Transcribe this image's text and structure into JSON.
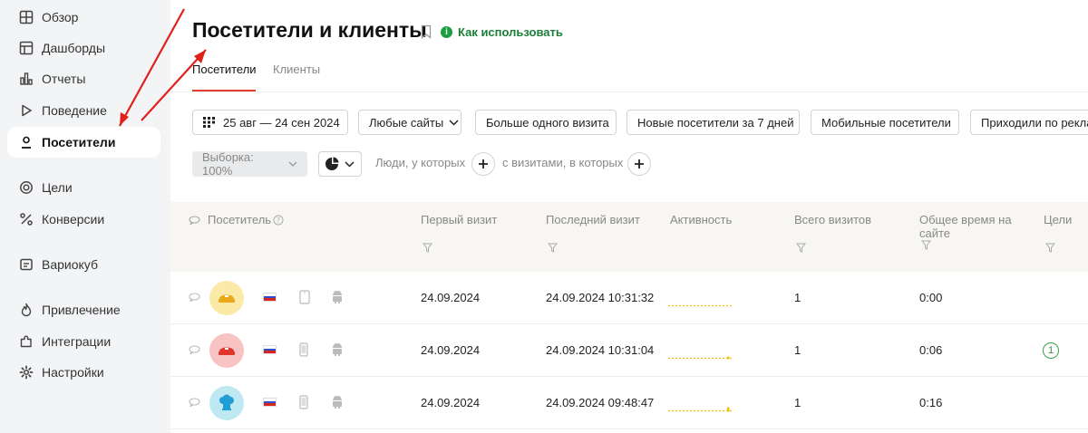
{
  "sidebar": {
    "items": [
      {
        "label": "Обзор",
        "icon": "grid-icon",
        "active": false
      },
      {
        "label": "Дашборды",
        "icon": "dashboard-icon",
        "active": false
      },
      {
        "label": "Отчеты",
        "icon": "bar-chart-icon",
        "active": false
      },
      {
        "label": "Поведение",
        "icon": "play-icon",
        "active": false
      },
      {
        "label": "Посетители",
        "icon": "person-icon",
        "active": true
      },
      {
        "label": "Цели",
        "icon": "target-icon",
        "active": false
      },
      {
        "label": "Конверсии",
        "icon": "percent-icon",
        "active": false
      },
      {
        "label": "Вариокуб",
        "icon": "variocube-icon",
        "active": false
      },
      {
        "label": "Привлечение",
        "icon": "flame-icon",
        "active": false
      },
      {
        "label": "Интеграции",
        "icon": "puzzle-icon",
        "active": false
      },
      {
        "label": "Настройки",
        "icon": "gear-icon",
        "active": false
      }
    ]
  },
  "header": {
    "title": "Посетители и клиенты",
    "howto": "Как использовать"
  },
  "tabs": [
    {
      "label": "Посетители",
      "active": true
    },
    {
      "label": "Клиенты",
      "active": false
    }
  ],
  "filters": {
    "date_range": "25 авг — 24 сен 2024",
    "sites": "Любые сайты",
    "presets": [
      "Больше одного визита",
      "Новые посетители за 7 дней",
      "Мобильные посетители",
      "Приходили по рекламе"
    ]
  },
  "segment": {
    "sample": "Выборка: 100%",
    "people_label": "Люди, у которых",
    "visits_label": "с визитами, в которых"
  },
  "table": {
    "columns": [
      "Посетитель",
      "Первый визит",
      "Последний визит",
      "Активность",
      "Всего визитов",
      "Общее время на сайте",
      "Цели"
    ],
    "rows": [
      {
        "first_visit": "24.09.2024",
        "last_visit": "24.09.2024 10:31:32",
        "total_visits": "1",
        "time_on_site": "0:00",
        "goals": "",
        "avatar_color": "#fbe9a8",
        "avatar_icon": "cap-icon",
        "device": "tablet-icon",
        "activity": 0.0
      },
      {
        "first_visit": "24.09.2024",
        "last_visit": "24.09.2024 10:31:04",
        "total_visits": "1",
        "time_on_site": "0:06",
        "goals": "1",
        "avatar_color": "#f7c3c3",
        "avatar_icon": "cap-icon",
        "device": "phone-icon",
        "activity": 0.3
      },
      {
        "first_visit": "24.09.2024",
        "last_visit": "24.09.2024 09:48:47",
        "total_visits": "1",
        "time_on_site": "0:16",
        "goals": "",
        "avatar_color": "#bfe9f2",
        "avatar_icon": "chef-hat-icon",
        "device": "phone-icon",
        "activity": 0.5
      }
    ]
  },
  "colors": {
    "accent_red": "#e23b31",
    "green": "#1a9e3e",
    "activity_yellow": "#f2c200"
  }
}
